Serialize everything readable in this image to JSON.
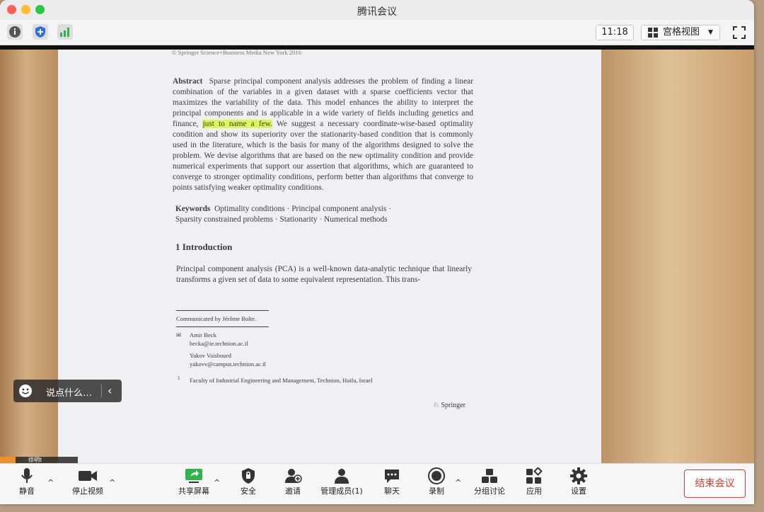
{
  "window": {
    "title": "腾讯会议"
  },
  "toolbar": {
    "time": "11:18",
    "view_label": "宫格视图"
  },
  "document": {
    "copyright": "© Springer Science+Business Media New York 2016",
    "abstract_label": "Abstract",
    "abstract_before": "Sparse principal component analysis addresses the problem of finding a linear combination of the variables in a given dataset with a sparse coefficients vector that maximizes the variability of the data. This model enhances the ability to interpret the principal components and is applicable in a wide variety of fields including genetics and finance, ",
    "abstract_highlight": "just to name a few.",
    "abstract_after": " We suggest a necessary coordinate-wise-based optimality condition and show its superiority over the stationarity-based condition that is commonly used in the literature, which is the basis for many of the algorithms designed to solve the problem. We devise algorithms that are based on the new optimality condition and provide numerical experiments that support our assertion that algorithms, which are guaranteed to converge to stronger optimality conditions, perform better than algorithms that converge to points satisfying weaker optimality conditions.",
    "keywords_label": "Keywords",
    "keywords_line1": "Optimality conditions · Principal component analysis ·",
    "keywords_line2": "Sparsity constrained problems · Stationarity · Numerical methods",
    "intro_heading": "1 Introduction",
    "intro_text": "Principal component analysis (PCA) is a well-known data-analytic technique that linearly transforms a given set of data to some equivalent representation. This trans-",
    "communicated": "Communicated by Jérôme Bolte.",
    "author1_name": "Amir Beck",
    "author1_email": "becka@ie.technion.ac.il",
    "author2_name": "Yakov Vaisbourd",
    "author2_email": "yakovv@campus.technion.ac.il",
    "footnote_mark": "1",
    "affiliation": "Faculty of Industrial Engineering and Management, Technion, Haifa, Israel",
    "publisher": "Springer"
  },
  "chat_overlay": {
    "placeholder": "说点什么…"
  },
  "participant_tag": {
    "name": "徐明t"
  },
  "bottom": {
    "mute": "静音",
    "stop_video": "停止视频",
    "share_screen": "共享屏幕",
    "security": "安全",
    "invite": "邀请",
    "manage_members": "管理成员(1)",
    "chat": "聊天",
    "record": "录制",
    "breakout": "分组讨论",
    "apps": "应用",
    "settings": "设置",
    "end_meeting": "结束会议"
  },
  "colors": {
    "accent_green": "#30b34a",
    "end_red": "#e0382f",
    "highlight": "#dff55a"
  }
}
